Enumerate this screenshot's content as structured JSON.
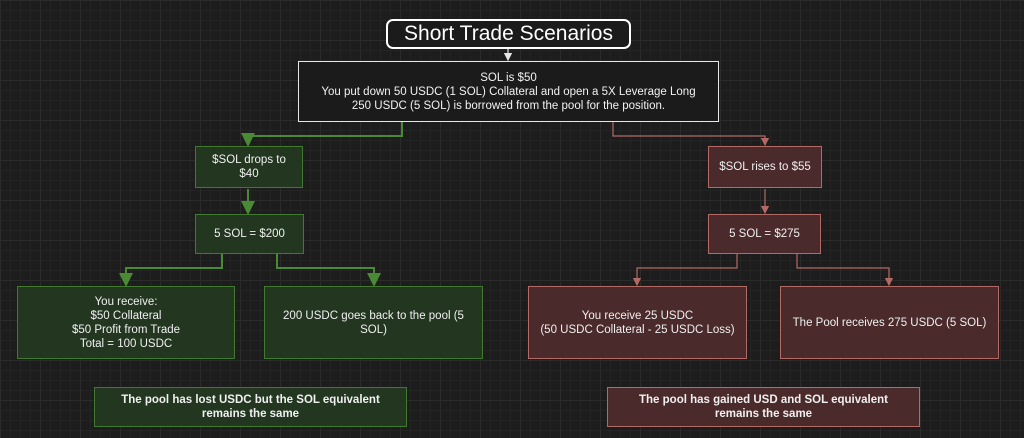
{
  "title": "Short Trade Scenarios",
  "root": {
    "line1": "SOL is $50",
    "line2": "You put down 50 USDC (1 SOL) Collateral and open a 5X Leverage Long",
    "line3": "250 USDC (5 SOL) is borrowed from the pool for the position."
  },
  "left_branch": {
    "drop": "$SOL drops to $40",
    "value": "5 SOL = $200",
    "receive": {
      "line1": "You receive:",
      "line2": "$50 Collateral",
      "line3": "$50 Profit from Trade",
      "line4": "Total = 100 USDC"
    },
    "pool": "200 USDC goes back to the pool (5 SOL)",
    "note": "The pool has lost USDC but the SOL equivalent remains the same"
  },
  "right_branch": {
    "rise": "$SOL rises to $55",
    "value": "5 SOL = $275",
    "receive": {
      "line1": "You receive 25 USDC",
      "line2": "(50 USDC Collateral - 25 USDC Loss)"
    },
    "pool": "The Pool receives 275 USDC (5 SOL)",
    "note": "The pool has gained USD and SOL equivalent remains the same"
  },
  "colors": {
    "background": "#1d1d1d",
    "green_fill": "#223620",
    "green_edge": "#4a8a35",
    "red_fill": "#4a2a2a",
    "red_edge": "#b46a64",
    "neutral_edge": "#e8e8e8"
  }
}
